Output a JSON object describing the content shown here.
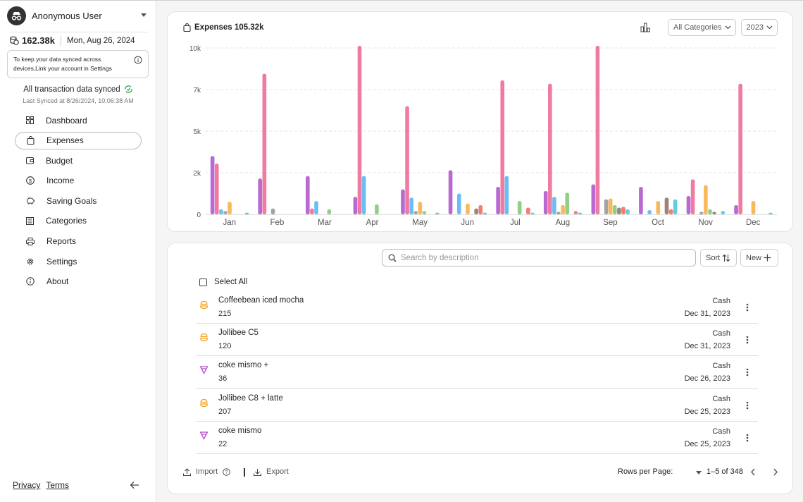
{
  "user": {
    "name": "Anonymous User"
  },
  "balance": {
    "amount": "162.38k",
    "date": "Mon, Aug 26, 2024"
  },
  "notice": {
    "text": "To keep your data synced across devices,Link your account in Settings"
  },
  "sync": {
    "status": "All transaction data synced",
    "last": "Last Synced at 8/26/2024, 10:06:38 AM"
  },
  "nav": [
    {
      "label": "Dashboard",
      "icon": "dashboard-icon"
    },
    {
      "label": "Expenses",
      "icon": "shopping-bag-icon"
    },
    {
      "label": "Budget",
      "icon": "wallet-icon"
    },
    {
      "label": "Income",
      "icon": "dollar-circle-icon"
    },
    {
      "label": "Saving Goals",
      "icon": "piggy-bank-icon"
    },
    {
      "label": "Categories",
      "icon": "list-icon"
    },
    {
      "label": "Reports",
      "icon": "printer-icon"
    },
    {
      "label": "Settings",
      "icon": "gear-icon"
    },
    {
      "label": "About",
      "icon": "info-icon"
    }
  ],
  "footer": {
    "privacy": "Privacy",
    "terms": "Terms"
  },
  "expenses_header": {
    "label": "Expenses",
    "total": "105.32k",
    "category_filter": "All Categories",
    "year_filter": "2023"
  },
  "colors": {
    "purple": "#b96ad2",
    "pink": "#f07ba0",
    "blue": "#6cbcf5",
    "gray": "#a3a3a3",
    "orange": "#f8b95c",
    "green": "#8fcf8a",
    "brown": "#a08378",
    "coral": "#f47c70",
    "cyan": "#5ccfe6"
  },
  "chart_data": {
    "type": "bar",
    "categories": [
      "Jan",
      "Feb",
      "Mar",
      "Apr",
      "May",
      "Jun",
      "Jul",
      "Aug",
      "Sep",
      "Oct",
      "Nov",
      "Dec"
    ],
    "y_ticks": [
      "0",
      "2k",
      "5k",
      "7k",
      "10k"
    ],
    "ylim": [
      0,
      10000
    ],
    "grid": true,
    "series": [
      {
        "color": "#b96ad2",
        "values": [
          3500,
          2150,
          2300,
          1050,
          1500,
          2650,
          1650,
          1400,
          1800,
          1650,
          1100,
          550
        ]
      },
      {
        "color": "#f07ba0",
        "values": [
          3050,
          8450,
          350,
          12700,
          6500,
          0,
          8050,
          7850,
          10600,
          0,
          2100,
          7850
        ]
      },
      {
        "color": "#6cbcf5",
        "values": [
          300,
          0,
          800,
          2300,
          1000,
          1250,
          2300,
          1050,
          0,
          250,
          0,
          0
        ]
      },
      {
        "color": "#a3a3a3",
        "values": [
          200,
          350,
          0,
          0,
          200,
          0,
          0,
          150,
          900,
          0,
          150,
          0
        ]
      },
      {
        "color": "#f8b95c",
        "values": [
          750,
          0,
          0,
          0,
          750,
          650,
          0,
          550,
          950,
          800,
          1750,
          800
        ]
      },
      {
        "color": "#8fcf8a",
        "values": [
          0,
          0,
          300,
          600,
          200,
          0,
          800,
          1300,
          550,
          0,
          300,
          0
        ]
      },
      {
        "color": "#a08378",
        "values": [
          0,
          0,
          0,
          0,
          0,
          350,
          0,
          0,
          400,
          1000,
          150,
          0
        ]
      },
      {
        "color": "#f47c70",
        "values": [
          0,
          0,
          0,
          0,
          0,
          550,
          400,
          200,
          450,
          300,
          0,
          0
        ]
      },
      {
        "color": "#5ccfe6",
        "values": [
          100,
          0,
          0,
          0,
          100,
          100,
          100,
          100,
          300,
          900,
          200,
          100
        ]
      }
    ]
  },
  "search": {
    "placeholder": "Search by description"
  },
  "buttons": {
    "sort": "Sort",
    "new": "New"
  },
  "select_all": "Select All",
  "transactions": [
    {
      "desc": "Coffeebean iced mocha",
      "amount": "215",
      "account": "Cash",
      "date": "Dec 31, 2023",
      "icon": "food-icon",
      "icon_color": "#f0a020"
    },
    {
      "desc": "Jollibee C5",
      "amount": "120",
      "account": "Cash",
      "date": "Dec 31, 2023",
      "icon": "food-icon",
      "icon_color": "#f0a020"
    },
    {
      "desc": "coke mismo +",
      "amount": "36",
      "account": "Cash",
      "date": "Dec 26, 2023",
      "icon": "drink-icon",
      "icon_color": "#b040c8"
    },
    {
      "desc": "Jollibee C8 + latte",
      "amount": "207",
      "account": "Cash",
      "date": "Dec 25, 2023",
      "icon": "food-icon",
      "icon_color": "#f0a020"
    },
    {
      "desc": "coke mismo",
      "amount": "22",
      "account": "Cash",
      "date": "Dec 25, 2023",
      "icon": "drink-icon",
      "icon_color": "#b040c8"
    }
  ],
  "list_footer": {
    "import": "Import",
    "export": "Export",
    "rows_per_page": "Rows per Page:",
    "range": "1–5 of 348"
  }
}
